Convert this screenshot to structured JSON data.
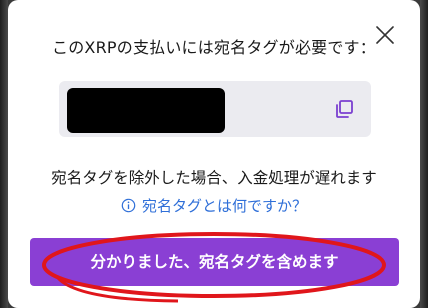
{
  "dialog": {
    "title": "このXRPの支払いには宛名タグが必要です：",
    "tag_value": "[redacted]",
    "warning": "宛名タグを除外した場合、入金処理が遅れます",
    "help_link": "宛名タグとは何ですか？",
    "confirm_label": "分かりました、宛名タグを含めます"
  },
  "icons": {
    "close": "close-icon",
    "copy": "copy-icon",
    "info": "info-circle-icon"
  },
  "colors": {
    "accent": "#8a3fd4",
    "link": "#2f6fd8",
    "annotation": "#e0161b",
    "tag_box": "#ebebf0"
  }
}
